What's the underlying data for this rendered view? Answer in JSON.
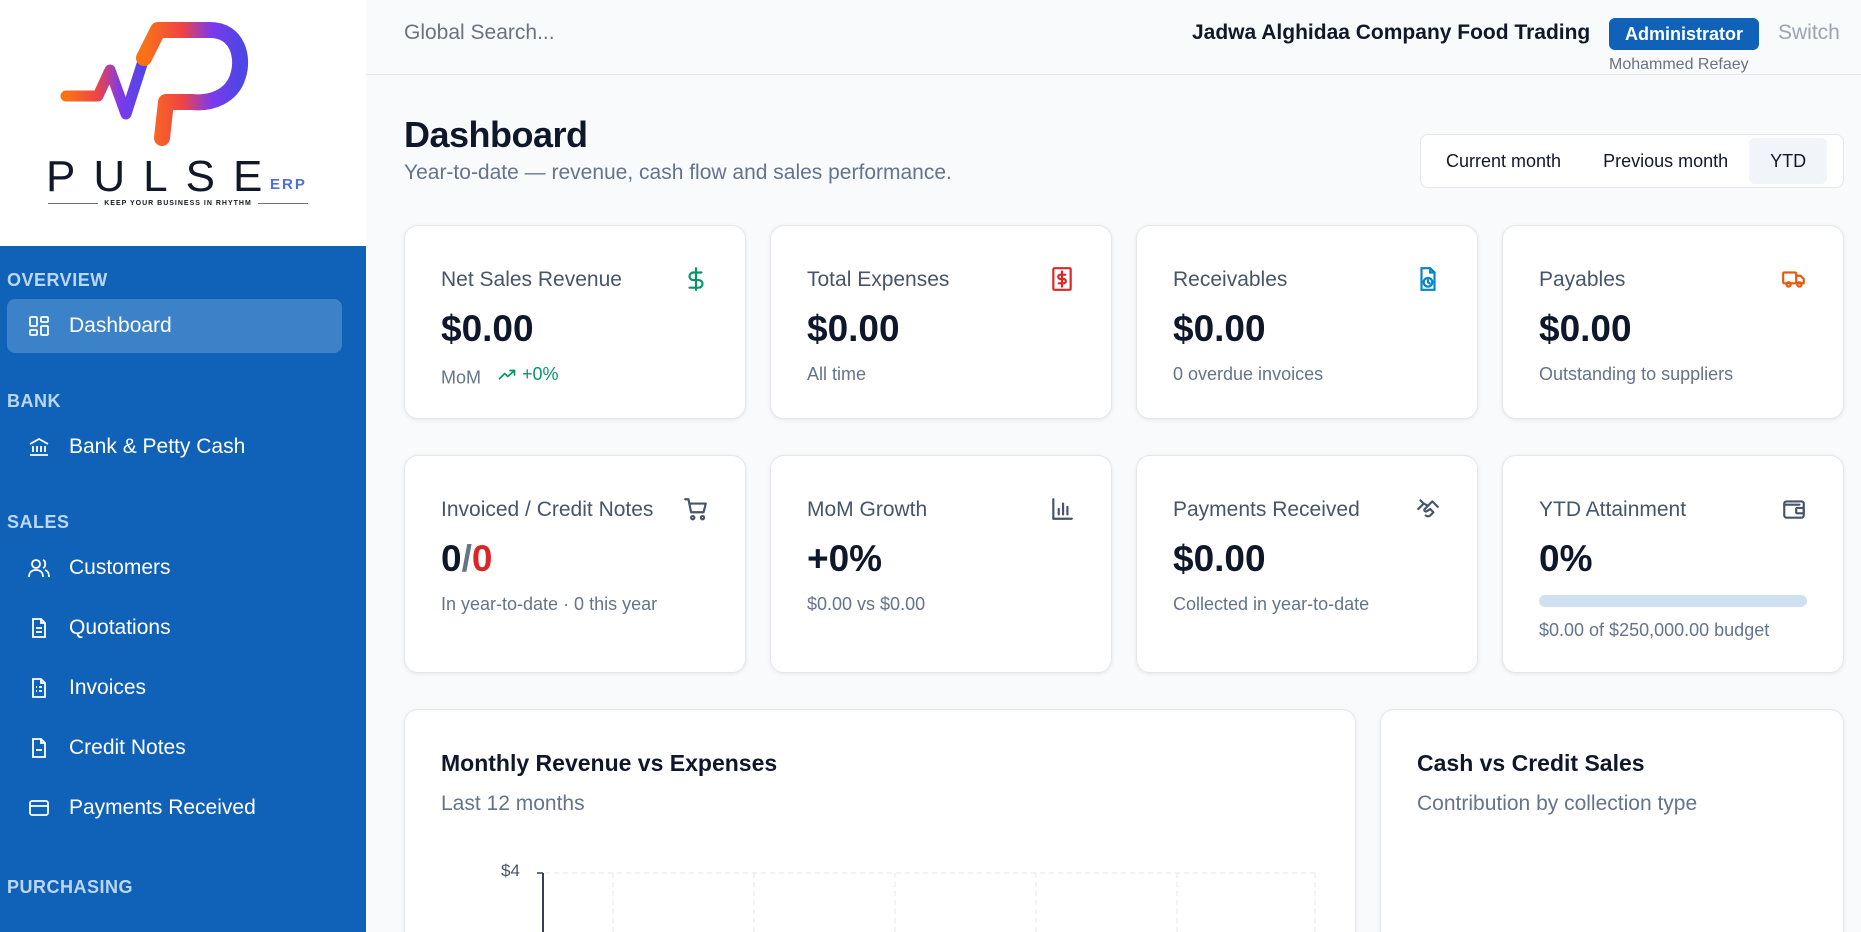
{
  "sidebar": {
    "logo": {
      "word": "PULSE",
      "suffix": "ERP",
      "tagline": "KEEP YOUR BUSINESS IN RHYTHM"
    },
    "sections": [
      {
        "label": "OVERVIEW",
        "items": [
          {
            "label": "Dashboard",
            "icon": "dashboard-icon",
            "active": true
          }
        ]
      },
      {
        "label": "BANK",
        "items": [
          {
            "label": "Bank & Petty Cash",
            "icon": "bank-icon"
          }
        ]
      },
      {
        "label": "SALES",
        "items": [
          {
            "label": "Customers",
            "icon": "users-icon"
          },
          {
            "label": "Quotations",
            "icon": "document-icon"
          },
          {
            "label": "Invoices",
            "icon": "invoice-icon"
          },
          {
            "label": "Credit Notes",
            "icon": "note-icon"
          },
          {
            "label": "Payments Received",
            "icon": "card-icon"
          }
        ]
      },
      {
        "label": "PURCHASING",
        "items": []
      }
    ]
  },
  "topbar": {
    "search_placeholder": "Global Search...",
    "company": "Jadwa Alghidaa Company Food Trading",
    "role": "Administrator",
    "switch_label": "Switch",
    "username": "Mohammed Refaey"
  },
  "header": {
    "title": "Dashboard",
    "subtitle": "Year-to-date — revenue, cash flow and sales performance.",
    "periods": [
      "Current month",
      "Previous month",
      "YTD"
    ],
    "selected_period": "YTD"
  },
  "cards": {
    "net_sales": {
      "label": "Net Sales Revenue",
      "value": "$0.00",
      "sub": "MoM",
      "trend": "+0%",
      "icon": "dollar-icon"
    },
    "expenses": {
      "label": "Total Expenses",
      "value": "$0.00",
      "sub": "All time",
      "icon": "receipt-dollar-icon"
    },
    "receivables": {
      "label": "Receivables",
      "value": "$0.00",
      "sub": "0 overdue invoices",
      "icon": "file-clock-icon"
    },
    "payables": {
      "label": "Payables",
      "value": "$0.00",
      "sub": "Outstanding to suppliers",
      "icon": "truck-icon"
    },
    "invoiced": {
      "label": "Invoiced / Credit Notes",
      "value_a": "0",
      "value_sep": "/",
      "value_b": "0",
      "sub": "In year-to-date · 0 this year",
      "icon": "cart-icon"
    },
    "mom_growth": {
      "label": "MoM Growth",
      "value": "+0%",
      "sub": "$0.00 vs $0.00",
      "icon": "bar-chart-icon"
    },
    "payments": {
      "label": "Payments Received",
      "value": "$0.00",
      "sub": "Collected in year-to-date",
      "icon": "handshake-icon"
    },
    "attainment": {
      "label": "YTD Attainment",
      "value": "0%",
      "progress_fraction": 0,
      "sub": "$0.00 of $250,000.00 budget",
      "icon": "wallet-icon"
    }
  },
  "panels": {
    "revenue": {
      "title": "Monthly Revenue vs Expenses",
      "subtitle": "Last 12 months",
      "y_tick_top": "$4"
    },
    "cash_credit": {
      "title": "Cash vs Credit Sales",
      "subtitle": "Contribution by collection type"
    }
  },
  "colors": {
    "brand": "#0f62b8",
    "positive": "#059669",
    "negative": "#dc2626"
  }
}
